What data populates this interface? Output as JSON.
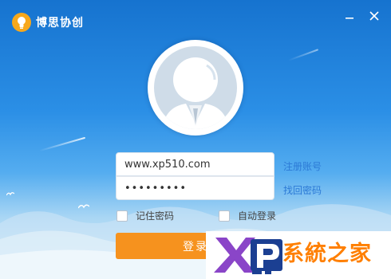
{
  "app": {
    "title": "博思协创",
    "logo_icon": "lightbulb-icon",
    "brand_color": "#f6921e"
  },
  "window_controls": {
    "minimize_icon": "minimize-icon",
    "close_icon": "close-icon"
  },
  "avatar": {
    "icon": "user-avatar-icon"
  },
  "login_form": {
    "account_value": "www.xp510.com",
    "password_value": "•••••••••",
    "register_link": "注册账号",
    "recover_link": "找回密码",
    "remember_password": {
      "label": "记住密码",
      "checked": false
    },
    "auto_login": {
      "label": "自动登录",
      "checked": false
    },
    "login_button": "登录"
  },
  "watermark": {
    "text": "系統之家",
    "logo_icon": "xp-logo-icon"
  }
}
